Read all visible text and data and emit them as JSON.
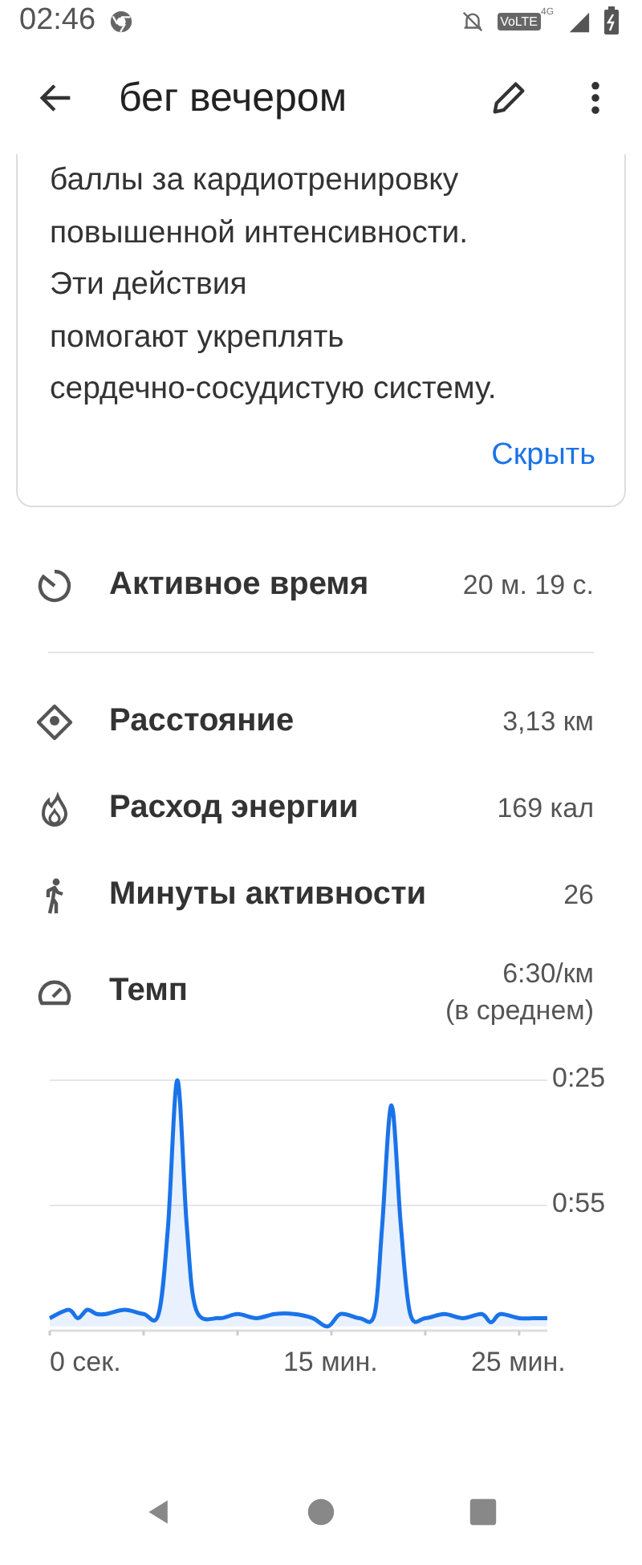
{
  "status_bar": {
    "time": "02:46",
    "network_badge": "VoLTE",
    "network_type": "4G"
  },
  "app_bar": {
    "title": "бег вечером"
  },
  "info_card": {
    "text": "баллы за кардиотренировку\nповышенной интенсивности.\nЭти действия\nпомогают укреплять\nсердечно-сосудистую систему.",
    "action": "Скрыть"
  },
  "summary": [
    {
      "kind": "timer",
      "label": "Активное время",
      "value": "20 м. 19 с."
    }
  ],
  "stats": [
    {
      "kind": "distance",
      "label": "Расстояние",
      "value": "3,13 км"
    },
    {
      "kind": "energy",
      "label": "Расход энергии",
      "value": "169 кал"
    },
    {
      "kind": "walk",
      "label": "Минуты активности",
      "value": "26"
    },
    {
      "kind": "pace",
      "label": "Темп",
      "value": "6:30/км\n(в среднем)"
    }
  ],
  "chart": {
    "chart_data": {
      "type": "line",
      "x": [
        0,
        1,
        1.5,
        2,
        2.5,
        3,
        4,
        5,
        5.8,
        6.3,
        6.8,
        7.3,
        7.8,
        9,
        10,
        11,
        12,
        13,
        14,
        14.8,
        15.5,
        16.5,
        17.3,
        17.7,
        18.2,
        18.7,
        19.2,
        20,
        21,
        22,
        23,
        23.5,
        24,
        25,
        26,
        26.5
      ],
      "series": [
        {
          "color": "#1a73e8",
          "values": [
            82,
            80,
            82,
            80,
            81,
            81,
            80,
            81,
            81,
            60,
            25,
            60,
            80,
            82,
            81,
            82,
            81,
            81,
            82,
            84,
            81,
            82,
            81,
            60,
            31,
            60,
            81,
            82,
            81,
            82,
            81,
            83,
            81,
            82,
            82,
            82
          ]
        }
      ],
      "xlim": [
        0,
        26.5
      ],
      "ylim": [
        85,
        25
      ],
      "xticks": [
        {
          "value": 0,
          "label": "0 сек."
        },
        {
          "value": 15,
          "label": "15 мин."
        },
        {
          "value": 25,
          "label": "25 мин."
        }
      ],
      "yticks": [
        {
          "value": 25,
          "label": "0:25"
        },
        {
          "value": 55,
          "label": "0:55"
        }
      ]
    }
  }
}
